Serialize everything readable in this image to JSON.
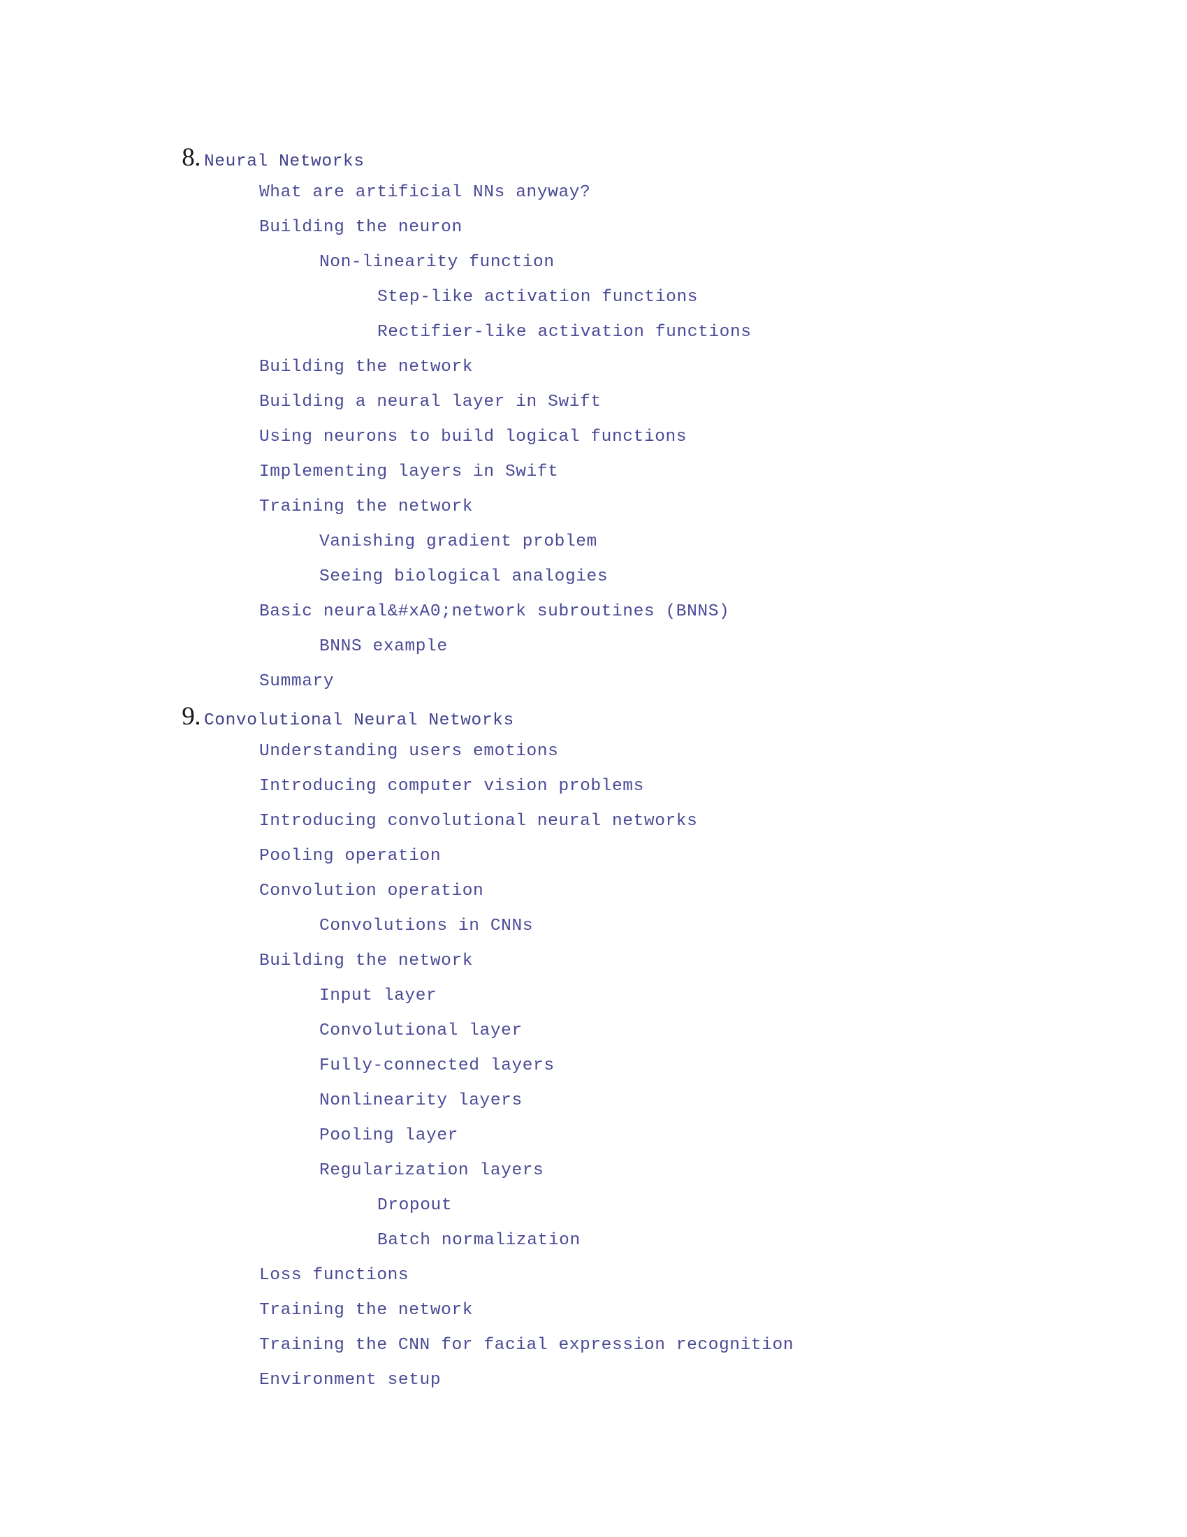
{
  "page": {
    "background_color": "#ffffff",
    "text_color": "#4a4a96",
    "number_color": "#1a1a1a",
    "kind": "table-of-contents"
  },
  "toc": {
    "chapters": [
      {
        "number": "8.",
        "title": "Neural Networks",
        "entries": [
          {
            "level": 1,
            "label": "What are artificial NNs anyway?"
          },
          {
            "level": 1,
            "label": "Building the neuron"
          },
          {
            "level": 2,
            "label": "Non-linearity function"
          },
          {
            "level": 3,
            "label": "Step-like activation functions"
          },
          {
            "level": 3,
            "label": "Rectifier-like activation functions"
          },
          {
            "level": 1,
            "label": "Building the network"
          },
          {
            "level": 1,
            "label": "Building a neural layer in Swift"
          },
          {
            "level": 1,
            "label": "Using neurons to build logical functions"
          },
          {
            "level": 1,
            "label": "Implementing layers in Swift"
          },
          {
            "level": 1,
            "label": "Training the network"
          },
          {
            "level": 2,
            "label": "Vanishing gradient problem"
          },
          {
            "level": 2,
            "label": "Seeing biological analogies"
          },
          {
            "level": 1,
            "label": "Basic neural&#xA0;network subroutines (BNNS)"
          },
          {
            "level": 2,
            "label": "BNNS example"
          },
          {
            "level": 1,
            "label": "Summary"
          }
        ]
      },
      {
        "number": "9.",
        "title": "Convolutional Neural Networks",
        "entries": [
          {
            "level": 1,
            "label": "Understanding users emotions"
          },
          {
            "level": 1,
            "label": "Introducing computer vision problems"
          },
          {
            "level": 1,
            "label": "Introducing convolutional neural networks"
          },
          {
            "level": 1,
            "label": "Pooling operation"
          },
          {
            "level": 1,
            "label": "Convolution operation"
          },
          {
            "level": 2,
            "label": "Convolutions in CNNs"
          },
          {
            "level": 1,
            "label": "Building the network"
          },
          {
            "level": 2,
            "label": "Input layer"
          },
          {
            "level": 2,
            "label": "Convolutional layer"
          },
          {
            "level": 2,
            "label": "Fully-connected layers"
          },
          {
            "level": 2,
            "label": "Nonlinearity layers"
          },
          {
            "level": 2,
            "label": "Pooling layer"
          },
          {
            "level": 2,
            "label": "Regularization layers"
          },
          {
            "level": 3,
            "label": "Dropout"
          },
          {
            "level": 3,
            "label": "Batch normalization"
          },
          {
            "level": 1,
            "label": "Loss functions"
          },
          {
            "level": 1,
            "label": "Training the network"
          },
          {
            "level": 1,
            "label": "Training the CNN for facial expression recognition"
          },
          {
            "level": 1,
            "label": "Environment setup"
          }
        ]
      }
    ]
  }
}
